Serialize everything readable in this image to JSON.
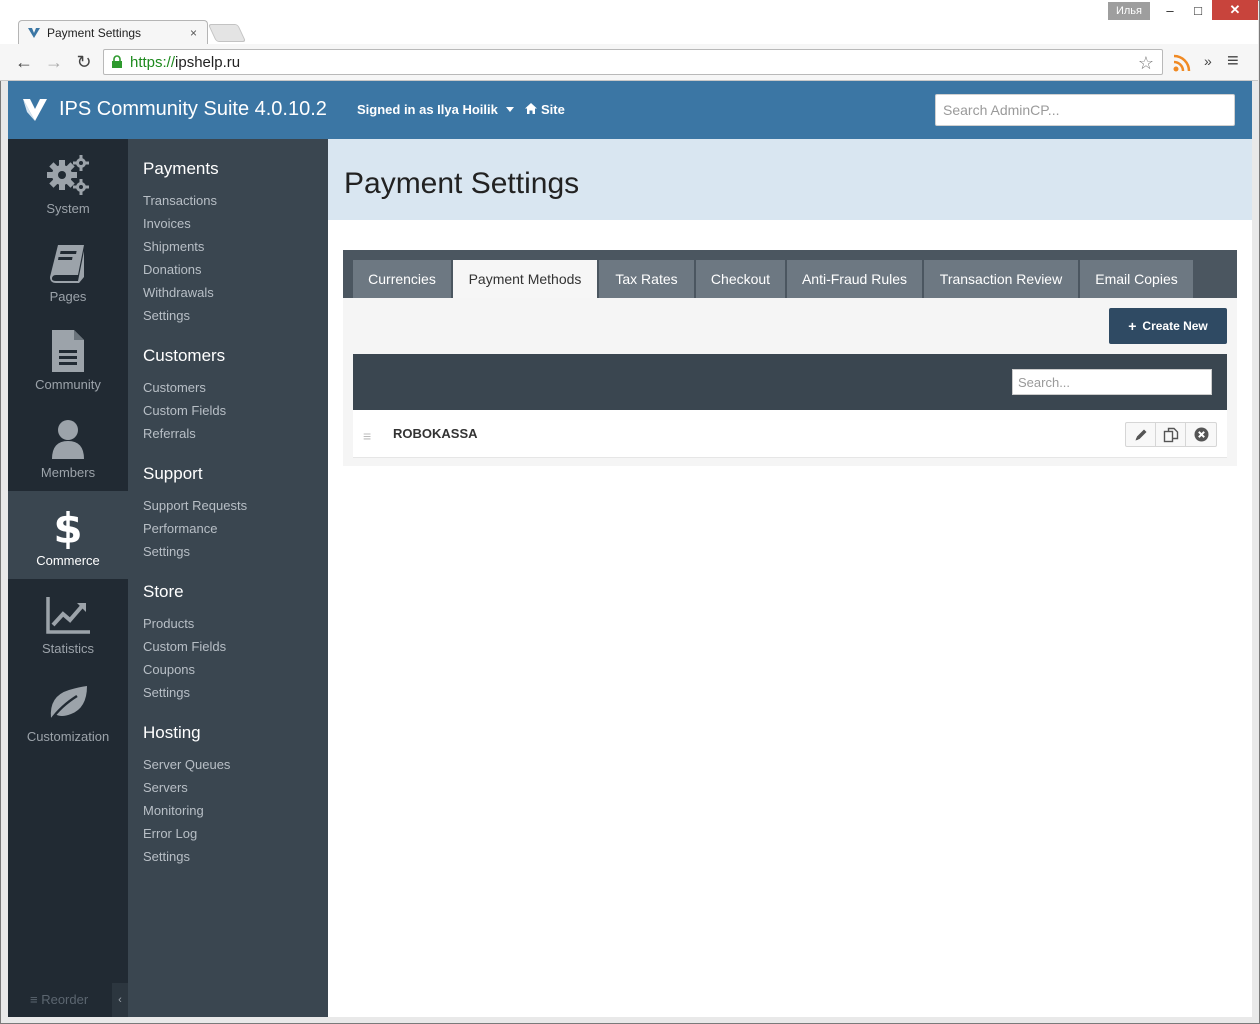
{
  "browser": {
    "tab_title": "Payment Settings",
    "tab_close": "×",
    "user_badge": "Илья",
    "min": "–",
    "max": "□",
    "close": "✕",
    "url_scheme": "https://",
    "url_host": "ipshelp.ru",
    "overflow": "»",
    "back": "←",
    "forward": "→",
    "reload": "↻",
    "menu": "≡",
    "star": "☆"
  },
  "header": {
    "title": "IPS Community Suite 4.0.10.2",
    "signed_in": "Signed in as Ilya Hoilik",
    "site": "Site",
    "search_placeholder": "Search AdminCP..."
  },
  "primary_nav": [
    {
      "label": "System",
      "icon": "gears-icon"
    },
    {
      "label": "Pages",
      "icon": "book-icon"
    },
    {
      "label": "Community",
      "icon": "document-icon"
    },
    {
      "label": "Members",
      "icon": "user-icon"
    },
    {
      "label": "Commerce",
      "icon": "dollar-icon",
      "active": true
    },
    {
      "label": "Statistics",
      "icon": "chart-icon"
    },
    {
      "label": "Customization",
      "icon": "leaf-icon"
    }
  ],
  "reorder": "≡ Reorder",
  "collapse": "‹",
  "secondary_nav": [
    {
      "heading": "Payments",
      "links": [
        "Transactions",
        "Invoices",
        "Shipments",
        "Donations",
        "Withdrawals",
        "Settings"
      ]
    },
    {
      "heading": "Customers",
      "links": [
        "Customers",
        "Custom Fields",
        "Referrals"
      ]
    },
    {
      "heading": "Support",
      "links": [
        "Support Requests",
        "Performance",
        "Settings"
      ]
    },
    {
      "heading": "Store",
      "links": [
        "Products",
        "Custom Fields",
        "Coupons",
        "Settings"
      ]
    },
    {
      "heading": "Hosting",
      "links": [
        "Server Queues",
        "Servers",
        "Monitoring",
        "Error Log",
        "Settings"
      ]
    }
  ],
  "main": {
    "page_title": "Payment Settings",
    "tabs": [
      "Currencies",
      "Payment Methods",
      "Tax Rates",
      "Checkout",
      "Anti-Fraud Rules",
      "Transaction Review",
      "Email Copies"
    ],
    "active_tab": "Payment Methods",
    "create_new": "Create New",
    "create_plus": "+",
    "search_placeholder": "Search...",
    "rows": [
      {
        "title": "ROBOKASSA"
      }
    ],
    "drag_handle": "≡"
  },
  "colors": {
    "header_blue": "#3b76a4",
    "nav_dark": "#212a33",
    "nav_secondary": "#3a4650",
    "page_header_bg": "#d9e6f1",
    "create_button": "#2f4a63"
  }
}
